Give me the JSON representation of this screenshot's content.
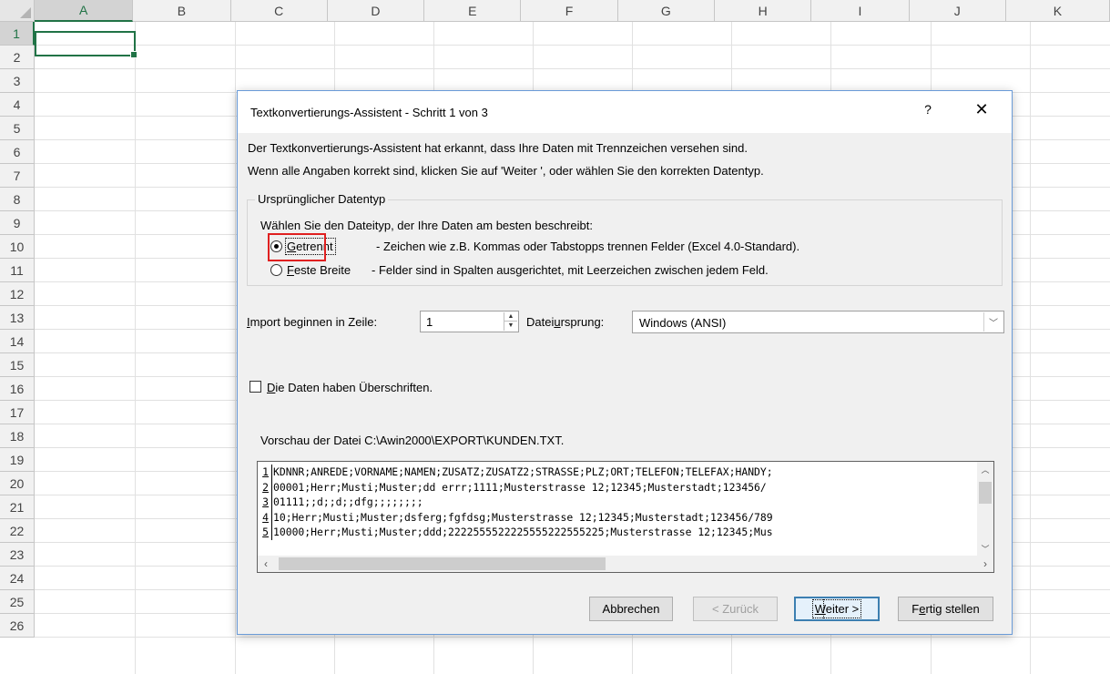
{
  "spreadsheet": {
    "columns": [
      "A",
      "B",
      "C",
      "D",
      "E",
      "F",
      "G",
      "H",
      "I",
      "J",
      "K"
    ],
    "rows": [
      "1",
      "2",
      "3",
      "4",
      "5",
      "6",
      "7",
      "8",
      "9",
      "10",
      "11",
      "12",
      "13",
      "14",
      "15",
      "16",
      "17",
      "18",
      "19",
      "20",
      "21",
      "22",
      "23",
      "24",
      "25",
      "26"
    ],
    "active_cell": "A1"
  },
  "dialog": {
    "title": "Textkonvertierungs-Assistent - Schritt 1 von 3",
    "help_label": "?",
    "close_label": "✕",
    "intro_line1": "Der Textkonvertierungs-Assistent hat erkannt, dass Ihre Daten mit Trennzeichen versehen sind.",
    "intro_line2": "Wenn alle Angaben korrekt sind, klicken Sie auf 'Weiter ', oder wählen Sie den korrekten Datentyp.",
    "group_title": "Ursprünglicher Datentyp",
    "group_prompt": "Wählen Sie den Dateityp, der Ihre Daten am besten beschreibt:",
    "option_delimited": {
      "label_accel": "G",
      "label_rest": "etrennt",
      "description": "- Zeichen wie z.B. Kommas oder Tabstopps trennen Felder (Excel 4.0-Standard).",
      "selected": true
    },
    "option_fixed": {
      "label_accel": "F",
      "label_rest": "este Breite",
      "description": "- Felder sind in Spalten ausgerichtet, mit Leerzeichen zwischen jedem Feld.",
      "selected": false
    },
    "start_row": {
      "label_accel": "I",
      "label_rest": "mport beginnen in Zeile:",
      "value": "1"
    },
    "file_origin": {
      "label_pre": "Datei",
      "label_accel": "u",
      "label_rest": "rsprung:",
      "value": "Windows (ANSI)"
    },
    "headers_checkbox": {
      "label_accel": "D",
      "label_rest": "ie Daten haben Überschriften.",
      "checked": false
    },
    "preview_label": "Vorschau der Datei C:\\Awin2000\\EXPORT\\KUNDEN.TXT.",
    "preview_lines": [
      {
        "num": "1",
        "text": "KDNNR;ANREDE;VORNAME;NAMEN;ZUSATZ;ZUSATZ2;STRASSE;PLZ;ORT;TELEFON;TELEFAX;HANDY;"
      },
      {
        "num": "2",
        "text": "00001;Herr;Musti;Muster;dd  errr;1111;Musterstrasse 12;12345;Musterstadt;123456/"
      },
      {
        "num": "3",
        "text": "01111;;d;;d;;dfg;;;;;;;;"
      },
      {
        "num": "4",
        "text": "10;Herr;Musti;Muster;dsferg;fgfdsg;Musterstrasse 12;12345;Musterstadt;123456/789"
      },
      {
        "num": "5",
        "text": "10000;Herr;Musti;Muster;ddd;2222555522225555222555225;Musterstrasse 12;12345;Mus"
      }
    ],
    "buttons": {
      "cancel": "Abbrechen",
      "back": "< Zurück",
      "next_accel": "W",
      "next_rest": "eiter >",
      "finish_pre": "F",
      "finish_accel": "e",
      "finish_rest": "rtig stellen"
    },
    "highlight_color": "#e02020",
    "accent_color": "#217346"
  }
}
